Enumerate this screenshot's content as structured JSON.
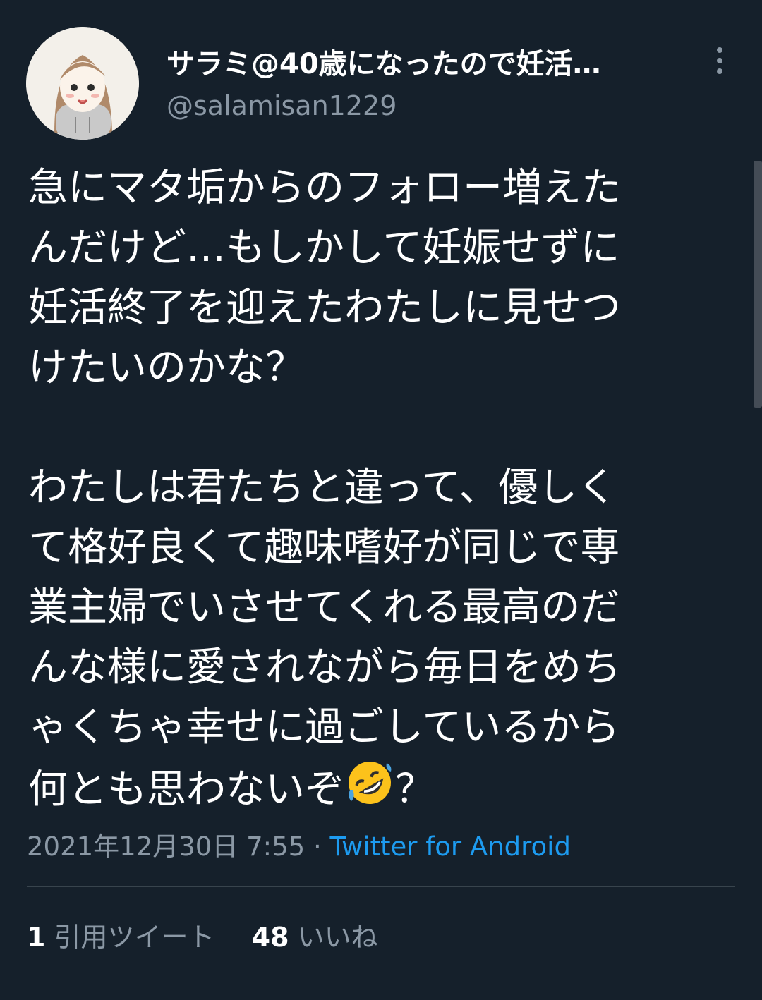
{
  "profile": {
    "display_name": "サラミ@40歳になったので妊活…",
    "handle": "@salamisan1229",
    "avatar_icon": "avatar-illustration"
  },
  "tweet": {
    "para1": [
      "急にマタ垢からのフォロー増えた",
      "んだけど…もしかして妊娠せずに",
      "妊活終了を迎えたわたしに見せつ",
      "けたいのかな？"
    ],
    "para2": [
      "わたしは君たちと違って、優しく",
      "て格好良くて趣味嗜好が同じで専",
      "業主婦でいさせてくれる最高のだ",
      "んな様に愛されながら毎日をめち",
      "ゃくちゃ幸せに過ごしているから"
    ],
    "last_line_text": "何とも思わないぞ",
    "last_line_emoji": "rolling-on-floor-laughing-icon",
    "last_line_end": "？"
  },
  "meta": {
    "datetime": "2021年12月30日 7:55",
    "separator": "·",
    "source": "Twitter for Android"
  },
  "stats": {
    "quotes_count": "1",
    "quotes_label": "引用ツイート",
    "likes_count": "48",
    "likes_label": "いいね"
  },
  "colors": {
    "background": "#15202b",
    "secondary_text": "#8b98a5",
    "link": "#1d9bf0",
    "divider": "#38444d"
  }
}
